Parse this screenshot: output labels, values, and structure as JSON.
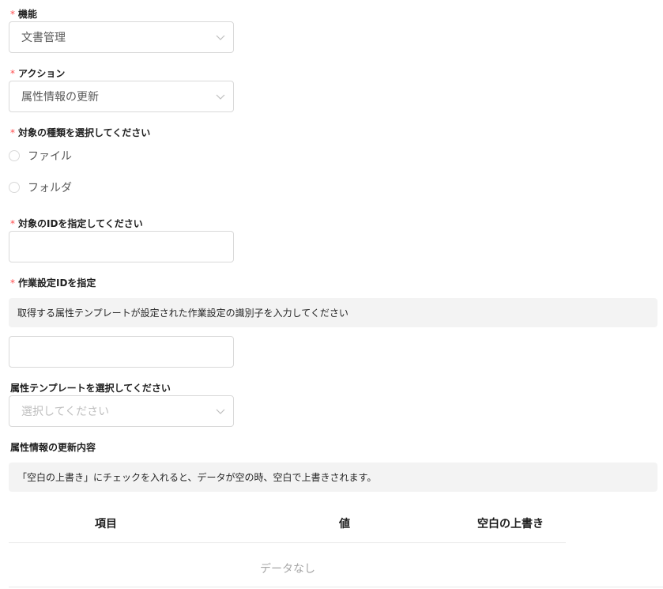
{
  "form": {
    "required_mark": "*",
    "function": {
      "label": "機能",
      "value": "文書管理"
    },
    "action": {
      "label": "アクション",
      "value": "属性情報の更新"
    },
    "target_type": {
      "label": "対象の種類を選択してください",
      "options": [
        "ファイル",
        "フォルダ"
      ]
    },
    "target_id": {
      "label": "対象のIDを指定してください",
      "value": ""
    },
    "work_setting_id": {
      "label": "作業設定IDを指定",
      "hint": "取得する属性テンプレートが設定された作業設定の識別子を入力してください",
      "value": ""
    },
    "attribute_template": {
      "label": "属性テンプレートを選択してください",
      "placeholder": "選択してください"
    },
    "update_contents": {
      "label": "属性情報の更新内容",
      "hint": "「空白の上書き」にチェックを入れると、データが空の時、空白で上書きされます。",
      "columns": [
        "項目",
        "値",
        "空白の上書き"
      ],
      "empty_text": "データなし"
    }
  },
  "colors": {
    "required": "#ff4d4f",
    "border": "#d9d9d9",
    "note_bg": "#f3f3f3"
  },
  "icons": {
    "select_arrow": "chevron-down-icon",
    "radio": "radio-circle-icon"
  }
}
